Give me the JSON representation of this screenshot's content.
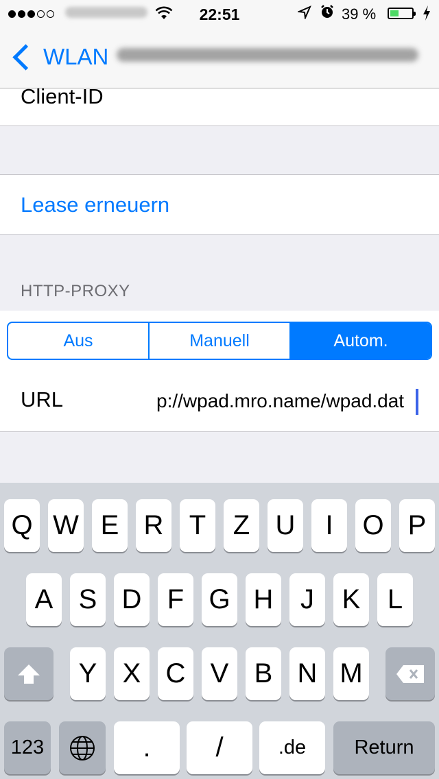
{
  "status_bar": {
    "signal_dots": [
      true,
      true,
      true,
      false,
      false
    ],
    "wifi_icon": "wifi-icon",
    "time": "22:51",
    "location_icon": "location-arrow-icon",
    "alarm_icon": "alarm-icon",
    "battery_percent": "39 %",
    "battery_level": 0.39,
    "charging_icon": "bolt-icon"
  },
  "nav": {
    "back_label": "WLAN",
    "back_icon": "chevron-left-icon"
  },
  "rows": {
    "client_id": "Client-ID",
    "lease_renew": "Lease erneuern"
  },
  "proxy": {
    "section_title": "HTTP-PROXY",
    "segments": [
      "Aus",
      "Manuell",
      "Autom."
    ],
    "selected_segment": "Autom.",
    "url_label": "URL",
    "url_value": "p://wpad.mro.name/wpad.dat"
  },
  "keyboard": {
    "row1": [
      "Q",
      "W",
      "E",
      "R",
      "T",
      "Z",
      "U",
      "I",
      "O",
      "P"
    ],
    "row2": [
      "A",
      "S",
      "D",
      "F",
      "G",
      "H",
      "J",
      "K",
      "L"
    ],
    "row3": [
      "Y",
      "X",
      "C",
      "V",
      "B",
      "N",
      "M"
    ],
    "shift_icon": "shift-arrow-icon",
    "delete_icon": "delete-backspace-icon",
    "numbers_label": "123",
    "globe_icon": "globe-icon",
    "dot_label": ".",
    "slash_label": "/",
    "tld_label": ".de",
    "return_label": "Return"
  },
  "colors": {
    "accent": "#007aff",
    "background": "#efeff4",
    "keyboard_bg": "#d1d5db",
    "battery_fill": "#4cd964"
  }
}
